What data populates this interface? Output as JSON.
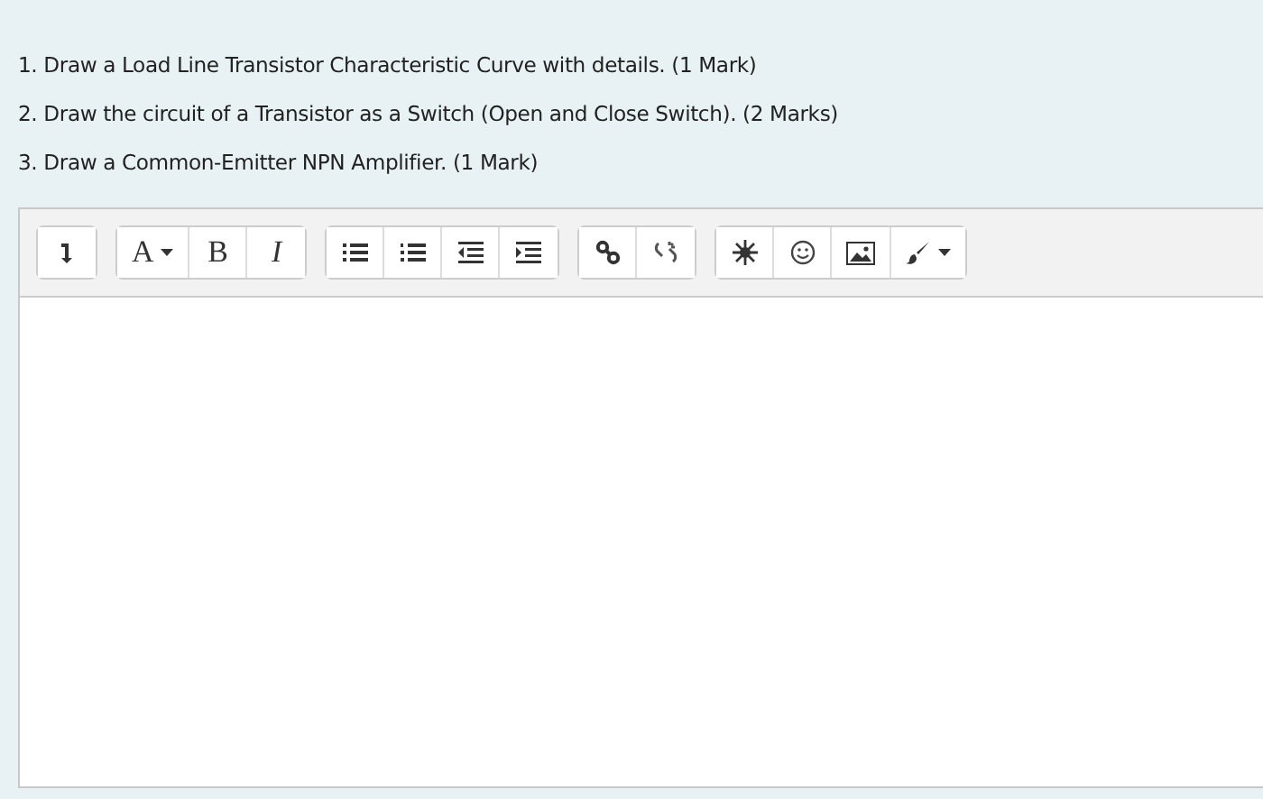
{
  "questions": [
    "1. Draw a Load Line Transistor Characteristic Curve with details. (1 Mark)",
    "2. Draw the circuit of a Transistor as a Switch (Open and Close Switch). (2 Marks)",
    "3. Draw a Common-Emitter NPN Amplifier. (1 Mark)"
  ],
  "toolbar": [
    [
      {
        "kind": "collapse"
      }
    ],
    [
      {
        "kind": "font",
        "label": "A",
        "dropdown": true
      },
      {
        "kind": "bold",
        "label": "B"
      },
      {
        "kind": "italic",
        "label": "I"
      }
    ],
    [
      {
        "kind": "bullets"
      },
      {
        "kind": "numbers"
      },
      {
        "kind": "outdent"
      },
      {
        "kind": "indent"
      }
    ],
    [
      {
        "kind": "link"
      },
      {
        "kind": "unlink"
      }
    ],
    [
      {
        "kind": "charmap"
      },
      {
        "kind": "emoji"
      },
      {
        "kind": "image"
      },
      {
        "kind": "paint",
        "dropdown": true
      }
    ]
  ]
}
